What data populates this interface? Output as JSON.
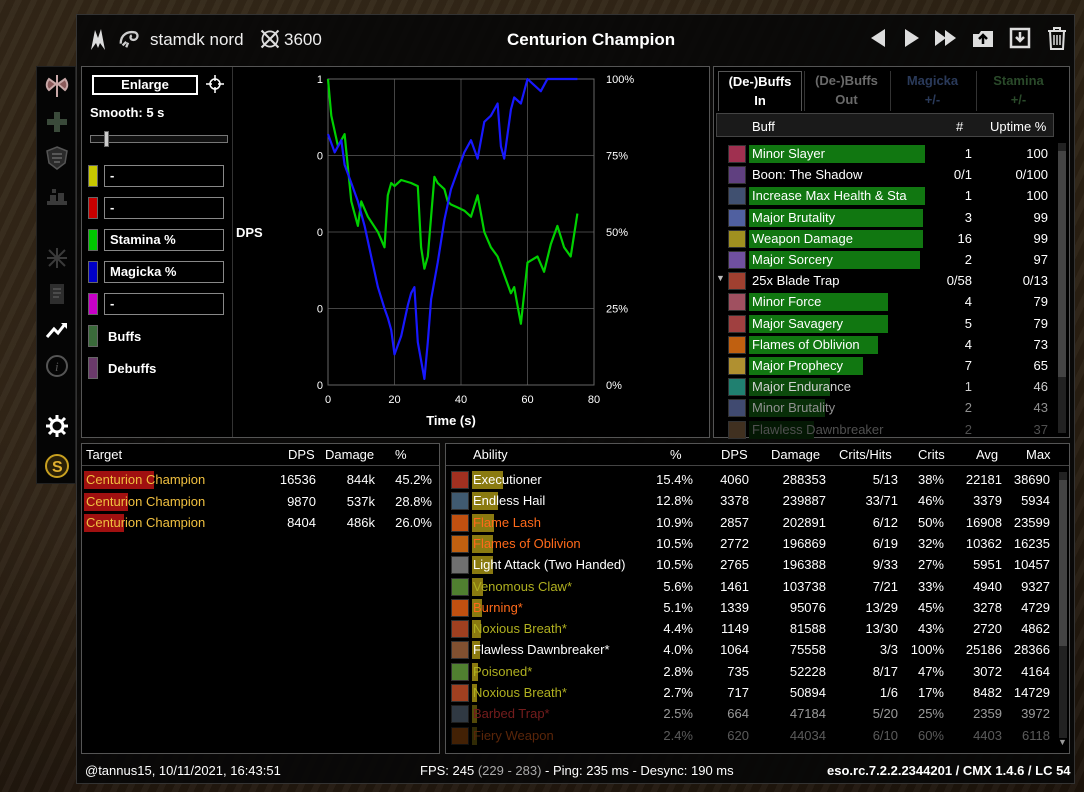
{
  "window": {
    "character": "stamdk nord",
    "time_icon_value": "3600",
    "title": "Centurion Champion"
  },
  "controls": {
    "enlarge_label": "Enlarge",
    "smooth_label": "Smooth: 5 s",
    "smooth_fraction": 0.09,
    "legend": [
      {
        "label": "-",
        "color": "#c8c800",
        "boxed": true
      },
      {
        "label": "-",
        "color": "#c80000",
        "boxed": true
      },
      {
        "label": "Stamina %",
        "color": "#00c800",
        "boxed": true
      },
      {
        "label": "Magicka %",
        "color": "#0000c8",
        "boxed": true
      },
      {
        "label": "-",
        "color": "#c800c8",
        "boxed": true
      },
      {
        "label": "Buffs",
        "color": "#3a6a3a",
        "boxed": false
      },
      {
        "label": "Debuffs",
        "color": "#6a3a6a",
        "boxed": false
      }
    ]
  },
  "chart_data": {
    "type": "line",
    "xlabel": "Time (s)",
    "ylabel": "DPS",
    "xlim": [
      0,
      80
    ],
    "x_ticks": [
      "0",
      "20",
      "40",
      "60",
      "80"
    ],
    "y_left_ticks": [
      "1",
      "0",
      "0",
      "0",
      "0"
    ],
    "y_right_ticks": [
      "100%",
      "75%",
      "50%",
      "25%",
      "0%"
    ],
    "grid": true,
    "series": [
      {
        "name": "Stamina %",
        "color": "#00d000",
        "x": [
          0,
          1,
          3,
          5,
          7,
          9,
          10,
          12,
          15,
          17,
          18,
          19,
          20,
          22,
          25,
          27,
          28,
          29,
          30,
          31,
          32,
          33,
          35,
          36,
          37,
          39,
          41,
          43,
          45,
          47,
          49,
          51,
          53,
          55,
          56,
          57,
          58,
          60,
          63,
          65,
          67,
          69,
          71,
          73,
          75
        ],
        "y": [
          100,
          88,
          78,
          82,
          60,
          52,
          60,
          55,
          50,
          45,
          62,
          66,
          65,
          67,
          66,
          65,
          45,
          38,
          42,
          55,
          68,
          66,
          64,
          60,
          59,
          58,
          57,
          55,
          62,
          50,
          45,
          42,
          36,
          30,
          32,
          26,
          20,
          40,
          42,
          37,
          46,
          52,
          45,
          42,
          56
        ]
      },
      {
        "name": "Magicka %",
        "color": "#1818ff",
        "x": [
          0,
          2,
          4,
          5,
          7,
          9,
          11,
          13,
          15,
          17,
          18,
          19,
          20,
          22,
          24,
          25,
          26,
          27,
          28,
          29,
          30,
          31,
          33,
          35,
          37,
          39,
          41,
          43,
          45,
          47,
          49,
          51,
          52,
          53,
          55,
          56,
          58,
          60,
          62,
          64,
          66,
          68,
          70,
          72,
          75
        ],
        "y": [
          82,
          76,
          80,
          72,
          66,
          60,
          52,
          42,
          32,
          25,
          22,
          18,
          10,
          16,
          26,
          30,
          32,
          14,
          8,
          2,
          14,
          28,
          40,
          54,
          64,
          70,
          76,
          80,
          74,
          86,
          88,
          92,
          78,
          74,
          90,
          94,
          92,
          100,
          98,
          96,
          100,
          100,
          100,
          100,
          100
        ]
      }
    ]
  },
  "buffs": {
    "tabs": [
      {
        "line1": "(De-)Buffs",
        "line2": "In",
        "color": "#ffffff"
      },
      {
        "line1": "(De-)Buffs",
        "line2": "Out",
        "color": "#6a6a6a"
      },
      {
        "line1": "Magicka",
        "line2": "+/-",
        "color": "#2a3a5a"
      },
      {
        "line1": "Stamina",
        "line2": "+/-",
        "color": "#2a4a2a"
      }
    ],
    "headers": {
      "name": "Buff",
      "count": "#",
      "uptime": "Uptime %"
    },
    "rows": [
      {
        "name": "Minor Slayer",
        "count": "1",
        "uptime": "100",
        "fill": 1.0,
        "bar": "#117711",
        "icon": "#a03050",
        "text": "#ffffff",
        "expander": ""
      },
      {
        "name": "Boon: The Shadow",
        "count": "0/1",
        "uptime": "0/100",
        "fill": 0,
        "bar": "#117711",
        "icon": "#604080",
        "text": "#ffffff",
        "expander": ""
      },
      {
        "name": "Increase Max Health & Sta",
        "count": "1",
        "uptime": "100",
        "fill": 1.0,
        "bar": "#117711",
        "icon": "#405070",
        "text": "#ffffff",
        "expander": ""
      },
      {
        "name": "Major Brutality",
        "count": "3",
        "uptime": "99",
        "fill": 0.99,
        "bar": "#117711",
        "icon": "#5060a0",
        "text": "#ffffff",
        "expander": ""
      },
      {
        "name": "Weapon Damage",
        "count": "16",
        "uptime": "99",
        "fill": 0.99,
        "bar": "#117711",
        "icon": "#a09020",
        "text": "#ffffff",
        "expander": ""
      },
      {
        "name": "Major Sorcery",
        "count": "2",
        "uptime": "97",
        "fill": 0.97,
        "bar": "#117711",
        "icon": "#7050a0",
        "text": "#ffffff",
        "expander": ""
      },
      {
        "name": "25x Blade Trap",
        "count": "0/58",
        "uptime": "0/13",
        "fill": 0,
        "bar": "#117711",
        "icon": "#a04030",
        "text": "#ffffff",
        "expander": "▼"
      },
      {
        "name": "Minor Force",
        "count": "4",
        "uptime": "79",
        "fill": 0.79,
        "bar": "#117711",
        "icon": "#a05060",
        "text": "#ffffff",
        "expander": ""
      },
      {
        "name": "Major Savagery",
        "count": "5",
        "uptime": "79",
        "fill": 0.79,
        "bar": "#117711",
        "icon": "#a04040",
        "text": "#ffffff",
        "expander": ""
      },
      {
        "name": "Flames of Oblivion",
        "count": "4",
        "uptime": "73",
        "fill": 0.73,
        "bar": "#117711",
        "icon": "#c06010",
        "text": "#ffffff",
        "expander": ""
      },
      {
        "name": "Major Prophecy",
        "count": "7",
        "uptime": "65",
        "fill": 0.65,
        "bar": "#117711",
        "icon": "#b09030",
        "text": "#ffffff",
        "expander": ""
      },
      {
        "name": "Major Endurance",
        "count": "1",
        "uptime": "46",
        "fill": 0.46,
        "bar": "#0c4a0c",
        "icon": "#208070",
        "text": "#d0d0d0",
        "expander": ""
      },
      {
        "name": "Minor Brutality",
        "count": "2",
        "uptime": "43",
        "fill": 0.43,
        "bar": "#082e08",
        "icon": "#404a70",
        "text": "#909090",
        "expander": ""
      },
      {
        "name": "Flawless Dawnbreaker",
        "count": "2",
        "uptime": "37",
        "fill": 0.37,
        "bar": "#041804",
        "icon": "#403020",
        "text": "#505050",
        "expander": ""
      }
    ]
  },
  "targets": {
    "headers": {
      "target": "Target",
      "dps": "DPS",
      "damage": "Damage",
      "pct": "%"
    },
    "rows": [
      {
        "name": "Centurion Champion",
        "dps": "16536",
        "damage": "844k",
        "pct": "45.2%",
        "fill": 0.452
      },
      {
        "name": "Centurion Champion",
        "dps": "9870",
        "damage": "537k",
        "pct": "28.8%",
        "fill": 0.288
      },
      {
        "name": "Centurion Champion",
        "dps": "8404",
        "damage": "486k",
        "pct": "26.0%",
        "fill": 0.26
      }
    ]
  },
  "abilities": {
    "headers": {
      "ability": "Ability",
      "pct": "%",
      "dps": "DPS",
      "damage": "Damage",
      "critshits": "Crits/Hits",
      "crits": "Crits",
      "avg": "Avg",
      "max": "Max"
    },
    "rows": [
      {
        "name": "Executioner",
        "pct": "15.4%",
        "dps": "4060",
        "damage": "288353",
        "critshits": "5/13",
        "crits": "38%",
        "avg": "22181",
        "max": "38690",
        "fill": 0.154,
        "color": "#ffffff",
        "icon": "#a03020"
      },
      {
        "name": "Endless Hail",
        "pct": "12.8%",
        "dps": "3378",
        "damage": "239887",
        "critshits": "33/71",
        "crits": "46%",
        "avg": "3379",
        "max": "5934",
        "fill": 0.128,
        "color": "#ffffff",
        "icon": "#405a70"
      },
      {
        "name": "Flame Lash",
        "pct": "10.9%",
        "dps": "2857",
        "damage": "202891",
        "critshits": "6/12",
        "crits": "50%",
        "avg": "16908",
        "max": "23599",
        "fill": 0.109,
        "color": "#ff6a1a",
        "icon": "#c05010"
      },
      {
        "name": "Flames of Oblivion",
        "pct": "10.5%",
        "dps": "2772",
        "damage": "196869",
        "critshits": "6/19",
        "crits": "32%",
        "avg": "10362",
        "max": "16235",
        "fill": 0.105,
        "color": "#ff6a1a",
        "icon": "#c06010"
      },
      {
        "name": "Light Attack (Two Handed)",
        "pct": "10.5%",
        "dps": "2765",
        "damage": "196388",
        "critshits": "9/33",
        "crits": "27%",
        "avg": "5951",
        "max": "10457",
        "fill": 0.105,
        "color": "#ffffff",
        "icon": "#707070"
      },
      {
        "name": "Venomous Claw*",
        "pct": "5.6%",
        "dps": "1461",
        "damage": "103738",
        "critshits": "7/21",
        "crits": "33%",
        "avg": "4940",
        "max": "9327",
        "fill": 0.056,
        "color": "#b0b020",
        "icon": "#508030"
      },
      {
        "name": "Burning*",
        "pct": "5.1%",
        "dps": "1339",
        "damage": "95076",
        "critshits": "13/29",
        "crits": "45%",
        "avg": "3278",
        "max": "4729",
        "fill": 0.051,
        "color": "#ff6a1a",
        "icon": "#c05010"
      },
      {
        "name": "Noxious Breath*",
        "pct": "4.4%",
        "dps": "1149",
        "damage": "81588",
        "critshits": "13/30",
        "crits": "43%",
        "avg": "2720",
        "max": "4862",
        "fill": 0.044,
        "color": "#b0b020",
        "icon": "#a04020"
      },
      {
        "name": "Flawless Dawnbreaker*",
        "pct": "4.0%",
        "dps": "1064",
        "damage": "75558",
        "critshits": "3/3",
        "crits": "100%",
        "avg": "25186",
        "max": "28366",
        "fill": 0.04,
        "color": "#ffffff",
        "icon": "#805030"
      },
      {
        "name": "Poisoned*",
        "pct": "2.8%",
        "dps": "735",
        "damage": "52228",
        "critshits": "8/17",
        "crits": "47%",
        "avg": "3072",
        "max": "4164",
        "fill": 0.028,
        "color": "#b0b020",
        "icon": "#508030"
      },
      {
        "name": "Noxious Breath*",
        "pct": "2.7%",
        "dps": "717",
        "damage": "50894",
        "critshits": "1/6",
        "crits": "17%",
        "avg": "8482",
        "max": "14729",
        "fill": 0.027,
        "color": "#b0b020",
        "icon": "#a04020"
      },
      {
        "name": "Barbed Trap*",
        "pct": "2.5%",
        "dps": "664",
        "damage": "47184",
        "critshits": "5/20",
        "crits": "25%",
        "avg": "2359",
        "max": "3972",
        "fill": 0.025,
        "color": "#c03030",
        "icon": "#506070"
      },
      {
        "name": "Fiery Weapon",
        "pct": "2.4%",
        "dps": "620",
        "damage": "44034",
        "critshits": "6/10",
        "crits": "60%",
        "avg": "4403",
        "max": "6118",
        "fill": 0.024,
        "color": "#ff6a1a",
        "icon": "#c06010"
      }
    ]
  },
  "footer": {
    "left": "@tannus15, 10/11/2021, 16:43:51",
    "fps_label": "FPS: 245",
    "fps_range": "(229 - 283)",
    "ping": "- Ping: 235 ms - Desync: 190 ms",
    "version": "eso.rc.7.2.2.2344201 / CMX 1.4.6 / LC 54"
  },
  "icons": [
    "class-emblem-icon",
    "pet-icon",
    "clock-icon",
    "arrow-left-icon",
    "arrow-right-icon",
    "fast-forward-icon",
    "upload-icon",
    "save-icon",
    "trash-icon",
    "crosshair-icon"
  ]
}
